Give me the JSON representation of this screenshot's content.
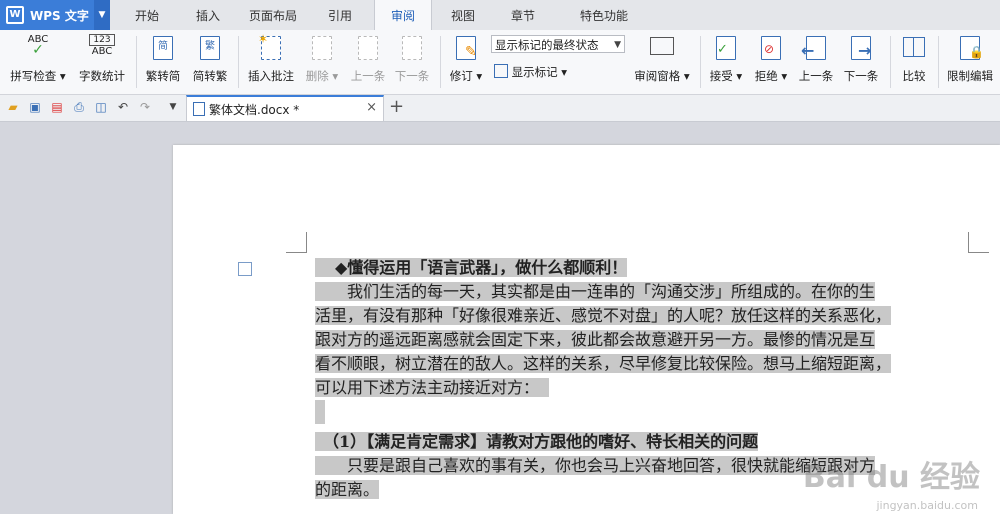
{
  "app": {
    "title": "WPS 文字",
    "logo": "W"
  },
  "tabs": [
    "开始",
    "插入",
    "页面布局",
    "引用",
    "审阅",
    "视图",
    "章节",
    "特色功能"
  ],
  "active_tab": "审阅",
  "ribbon": {
    "spell_check": "拼写检查",
    "word_count": "字数统计",
    "trad_to_simp": "繁转简",
    "simp_to_trad": "简转繁",
    "insert_comment": "插入批注",
    "delete": "删除",
    "prev_comment": "上一条",
    "next_comment": "下一条",
    "revise": "修订",
    "display_mode": "显示标记的最终状态",
    "show_markup": "显示标记",
    "review_pane": "审阅窗格",
    "accept": "接受",
    "reject": "拒绝",
    "prev_change": "上一条",
    "next_change": "下一条",
    "compare": "比较",
    "restrict_edit": "限制编辑",
    "abc_top": "ABC",
    "num_top": "123",
    "abc_bottom": "ABC",
    "trad_icon_glyph": "简",
    "simp_icon_glyph": "繁"
  },
  "document_tab": {
    "name": "繁体文档.docx *",
    "close": "×",
    "new": "+"
  },
  "document": {
    "heading": "◆懂得运用「语言武器」，做什么都顺利！",
    "para1": [
      "　　我们生活的每一天，其实都是由一连串的「沟通交涉」所组成的。在你的生",
      "活里，有没有那种「好像很难亲近、感觉不对盘」的人呢？放任这样的关系恶化，",
      "跟对方的遥远距离感就会固定下来，彼此都会故意避开另一方。最惨的情况是互",
      "看不顺眼，树立潜在的敌人。这样的关系，尽早修复比较保险。想马上缩短距离，",
      "可以用下述方法主动接近对方："
    ],
    "subheading": "　（1）【满足肯定需求】请教对方跟他的嗜好、特长相关的问题",
    "para2": [
      "　　只要是跟自己喜欢的事有关，你也会马上兴奋地回答，很快就能缩短跟对方",
      "的距离。"
    ]
  },
  "watermark": {
    "main": "Bai du 经验",
    "sub": "jingyan.baidu.com"
  },
  "colors": {
    "accent": "#3b7dd8",
    "highlight": "#c8c8c8"
  }
}
